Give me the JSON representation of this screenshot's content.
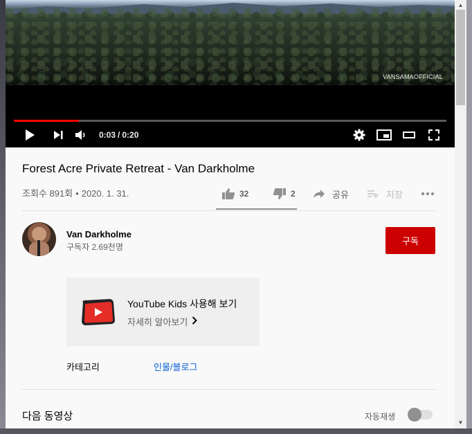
{
  "player": {
    "watermark": "VANSAMAOFFICIAL",
    "current_time": "0:03",
    "duration": "0:20",
    "progress_fraction": 0.15,
    "progress_color": "#ff0000",
    "icons": {
      "play": "play-icon",
      "next": "next-icon",
      "volume": "volume-icon",
      "settings": "gear-icon",
      "miniplayer": "miniplayer-icon",
      "theater": "theater-mode-icon",
      "fullscreen": "fullscreen-icon"
    }
  },
  "video": {
    "title": "Forest Acre Private Retreat - Van Darkholme",
    "views": "조회수 891회",
    "date": "2020. 1. 31."
  },
  "actions": {
    "likes": "32",
    "dislikes": "2",
    "share": "공유",
    "save": "저장"
  },
  "channel": {
    "name": "Van Darkholme",
    "subscribers": "구독자 2.69천명",
    "subscribe_label": "구독",
    "subscribe_color": "#cc0000"
  },
  "kids_card": {
    "title": "YouTube Kids 사용해 보기",
    "link": "자세히 알아보기"
  },
  "category": {
    "label": "카테고리",
    "value": "인물/블로그"
  },
  "up_next": {
    "heading": "다음 동영상",
    "autoplay_label": "자동재생",
    "autoplay_on": false
  }
}
